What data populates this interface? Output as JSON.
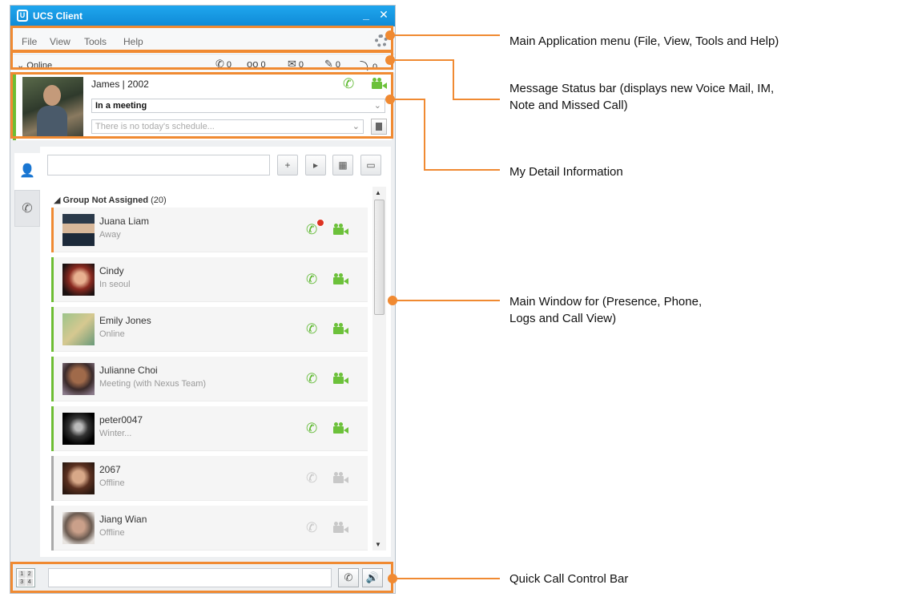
{
  "window": {
    "title": "UCS Client",
    "minimize": "_",
    "close": "✕"
  },
  "menu": {
    "items": [
      "File",
      "View",
      "Tools",
      "Help"
    ]
  },
  "status": {
    "presence": "Online",
    "counts": [
      "0",
      "0",
      "0",
      "0",
      "0"
    ]
  },
  "my_detail": {
    "name": "James | 2002",
    "status_message": "In a meeting",
    "schedule_placeholder": "There is no today's schedule..."
  },
  "contacts": {
    "group_name": "Group Not Assigned",
    "group_count": "(20)",
    "items": [
      {
        "name": "Juana Liam",
        "status": "Away",
        "bar": "#f08a32"
      },
      {
        "name": "Cindy",
        "status": "In seoul",
        "bar": "#6dbd33"
      },
      {
        "name": "Emily Jones",
        "status": "Online",
        "bar": "#6dbd33"
      },
      {
        "name": "Julianne Choi",
        "status": "Meeting (with Nexus Team)",
        "bar": "#6dbd33"
      },
      {
        "name": "peter0047",
        "status": "Winter...",
        "bar": "#6dbd33"
      },
      {
        "name": "2067",
        "status": "Offline",
        "bar": "#aaaaaa"
      },
      {
        "name": "Jiang Wian",
        "status": "Offline",
        "bar": "#aaaaaa"
      }
    ]
  },
  "dialpad_keys": [
    "1",
    "2",
    "3",
    "4"
  ],
  "callouts": {
    "menu": "Main Application menu (File, View, Tools and Help)",
    "status_line1": "Message Status bar (displays new Voice Mail, IM,",
    "status_line2": "Note and Missed Call)",
    "detail": "My Detail Information",
    "main_line1": "Main Window for (Presence, Phone,",
    "main_line2": "Logs and Call View)",
    "quick": "Quick Call Control Bar"
  },
  "colors": {
    "accent": "#f08a32",
    "title_bar": "#1299e3",
    "online_green": "#6dbd33"
  }
}
